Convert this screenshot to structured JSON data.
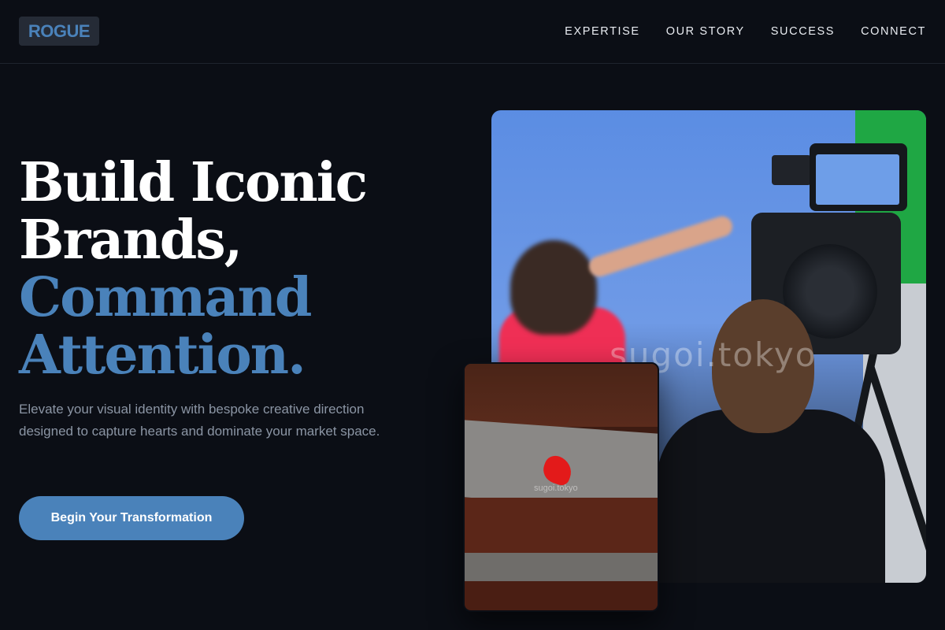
{
  "header": {
    "logo": "ROGUE",
    "nav": [
      {
        "label": "EXPERTISE"
      },
      {
        "label": "OUR STORY"
      },
      {
        "label": "SUCCESS"
      },
      {
        "label": "CONNECT"
      }
    ]
  },
  "hero": {
    "headline_line1": "Build Iconic",
    "headline_line2": "Brands,",
    "headline_line3": "Command",
    "headline_line4": "Attention.",
    "subtext": "Elevate your visual identity with bespoke creative direction designed to capture hearts and dominate your market space.",
    "cta_label": "Begin Your Transformation"
  },
  "images": {
    "main_watermark": "sugoi.tokyo",
    "small_watermark": "sugoi.tokyo"
  },
  "colors": {
    "background": "#0b0e15",
    "accent": "#4a82ba",
    "text_primary": "#ffffff",
    "text_muted": "#8b95a4"
  }
}
